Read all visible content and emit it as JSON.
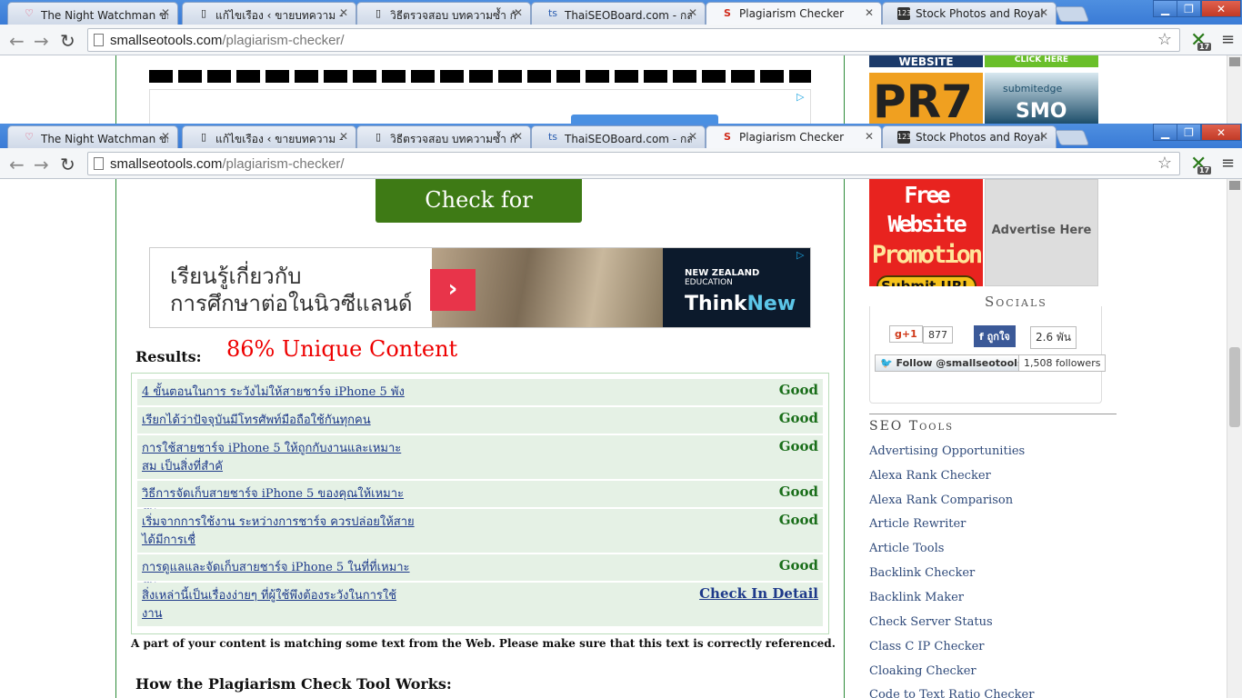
{
  "browser": {
    "tabs": [
      {
        "title": "The Night Watchman ของดี",
        "fav": "♡",
        "fav_color": "#e05070"
      },
      {
        "title": "แก้ไขเรือง ‹ ขายบทความ —",
        "fav": "▯",
        "fav_color": "#888888"
      },
      {
        "title": "วิธีตรวจสอบ บทความซ้ำ กันห",
        "fav": "▯",
        "fav_color": "#888888"
      },
      {
        "title": "ThaiSEOBoard.com - กลยุท",
        "fav": "ts",
        "fav_color": "#2a5db0"
      },
      {
        "title": "Plagiarism Checker",
        "fav": "S",
        "fav_color": "#d02a1a"
      },
      {
        "title": "Stock Photos and Royalty",
        "fav": "123",
        "fav_color": "#333333"
      }
    ],
    "url_domain": "smallseotools.com",
    "url_path": "/plagiarism-checker/",
    "window_controls": {
      "minimize": "▁",
      "restore": "❐",
      "close": "✕"
    },
    "ext_count": "17"
  },
  "win1": {
    "sidebar_top_left": "WEBSITE",
    "sidebar_top_right": "CLICK HERE",
    "pr_text": "PR7",
    "submitedge": "submitedge",
    "smo": "SMO"
  },
  "page": {
    "check_button": "Check for Plagiarism",
    "ad": {
      "line1": "เรียนรู้เกี่ยวกับ",
      "line2": "การศึกษาต่อในนิวซีแลนด์",
      "arrow": "›",
      "nz_line1": "NEW ZEALAND",
      "nz_line2": "EDUCATION",
      "think": "Think",
      "new": "New"
    },
    "results_label": "Results:",
    "unique_text": "86% Unique Content",
    "results": [
      {
        "text": "4 ขั้นตอนในการ ระวังไม่ให้สายชาร์จ iPhone 5 พัง",
        "status": "Good",
        "link": false
      },
      {
        "text": "เรียกได้ว่าปัจจุบันมีโทรศัพท์มือถือใช้กันทุกคน",
        "status": "Good",
        "link": false
      },
      {
        "text": "การใช้สายชาร์จ iPhone 5 ให้ถูกกับงานและเหมาะสม เป็นสิ่งที่สำคั",
        "status": "Good",
        "link": false
      },
      {
        "text": "วิธีการจัดเก็บสายชาร์จ iPhone 5 ของคุณให้เหมาะสม",
        "status": "Good",
        "link": false
      },
      {
        "text": "เริ่มจากการใช้งาน ระหว่างการชาร์จ ควรปล่อยให้สาย ได้มีการเชื่",
        "status": "Good",
        "link": false
      },
      {
        "text": "การดูแลและจัดเก็บสายชาร์จ iPhone 5 ในที่ที่เหมาะสม",
        "status": "Good",
        "link": false
      },
      {
        "text": "สิ่งเหล่านี้เป็นเรื่องง่ายๆ ที่ผู้ใช้พึงต้องระวังในการใช้งาน",
        "status": "Check In Detail",
        "link": true
      }
    ],
    "warning": "A part of your content is matching some text from the Web. Please make sure that this text is correctly referenced.",
    "howto": "How the Plagiarism Check Tool Works:"
  },
  "sidebar": {
    "free_promo_1": "Free Website",
    "free_promo_2": "Promotion",
    "submit_url": "Submit URL",
    "advertise": "Advertise Here",
    "socials_heading": "Socials",
    "gplus": "g+1",
    "gplus_count": "877",
    "fb_like": "ถูกใจ",
    "fb_count": "2.6 พัน",
    "twitter_follow": "Follow @smallseotools",
    "twitter_count": "1,508 followers",
    "seo_heading": "SEO Tools",
    "tools": [
      "Advertising Opportunities",
      "Alexa Rank Checker",
      "Alexa Rank Comparison",
      "Article Rewriter",
      "Article Tools",
      "Backlink Checker",
      "Backlink Maker",
      "Check Server Status",
      "Class C IP Checker",
      "Cloaking Checker",
      "Code to Text Ratio Checker"
    ]
  }
}
